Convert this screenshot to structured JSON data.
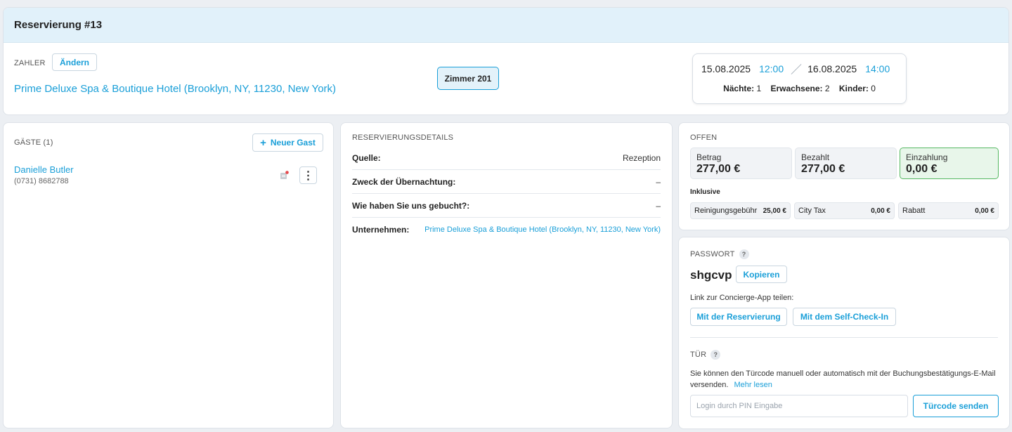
{
  "header": {
    "title": "Reservierung #13",
    "payer_label": "ZAHLER",
    "change_label": "Ändern",
    "payer_name": "Prime Deluxe Spa & Boutique Hotel (Brooklyn, NY, 11230, New York)",
    "room": "Zimmer 201",
    "checkin_date": "15.08.2025",
    "checkin_time": "12:00",
    "checkout_date": "16.08.2025",
    "checkout_time": "14:00",
    "nights_label": "Nächte:",
    "nights": "1",
    "adults_label": "Erwachsene:",
    "adults": "2",
    "children_label": "Kinder:",
    "children": "0"
  },
  "guests": {
    "title": "GÄSTE (1)",
    "new_guest_label": "Neuer Gast",
    "new_guest_plus": "+",
    "items": [
      {
        "name": "Danielle Butler",
        "phone": "(0731) 8682788",
        "menu_glyph": "⋮"
      }
    ]
  },
  "details": {
    "title": "RESERVIERUNGSDETAILS",
    "rows": [
      {
        "key": "Quelle:",
        "value": "Rezeption"
      },
      {
        "key": "Zweck der Übernachtung:",
        "value": "–"
      },
      {
        "key": "Wie haben Sie uns gebucht?:",
        "value": "–"
      },
      {
        "key": "Unternehmen:",
        "value": "Prime Deluxe Spa & Boutique Hotel (Brooklyn, NY, 11230, New York)"
      }
    ]
  },
  "payment": {
    "title": "OFFEN",
    "amount_label": "Betrag",
    "amount": "277,00 €",
    "paid_label": "Bezahlt",
    "paid": "277,00 €",
    "deposit_label": "Einzahlung",
    "deposit": "0,00 €",
    "inclusive_label": "Inklusive",
    "fees": [
      {
        "label": "Reinigungsgebühr",
        "value": "25,00 €"
      },
      {
        "label": "City Tax",
        "value": "0,00 €"
      },
      {
        "label": "Rabatt",
        "value": "0,00 €"
      }
    ],
    "deposit_color": "#56b862"
  },
  "password": {
    "title": "PASSWORT",
    "help": "?",
    "value": "shgcvp",
    "copy_label": "Kopieren",
    "share_label": "Link zur Concierge-App teilen:",
    "share_reservation": "Mit der Reservierung",
    "share_selfcheckin": "Mit dem Self-Check-In"
  },
  "door": {
    "title": "TÜR",
    "help": "?",
    "description": "Sie können den Türcode manuell oder automatisch mit der Buchungsbestätigungs-E-Mail versenden.",
    "more_label": "Mehr lesen",
    "pin_placeholder": "Login durch PIN Eingabe",
    "send_label": "Türcode senden"
  },
  "colors": {
    "accent": "#1a9fd8",
    "header_bg": "#e1f1fa",
    "page_bg": "#eceff3"
  }
}
